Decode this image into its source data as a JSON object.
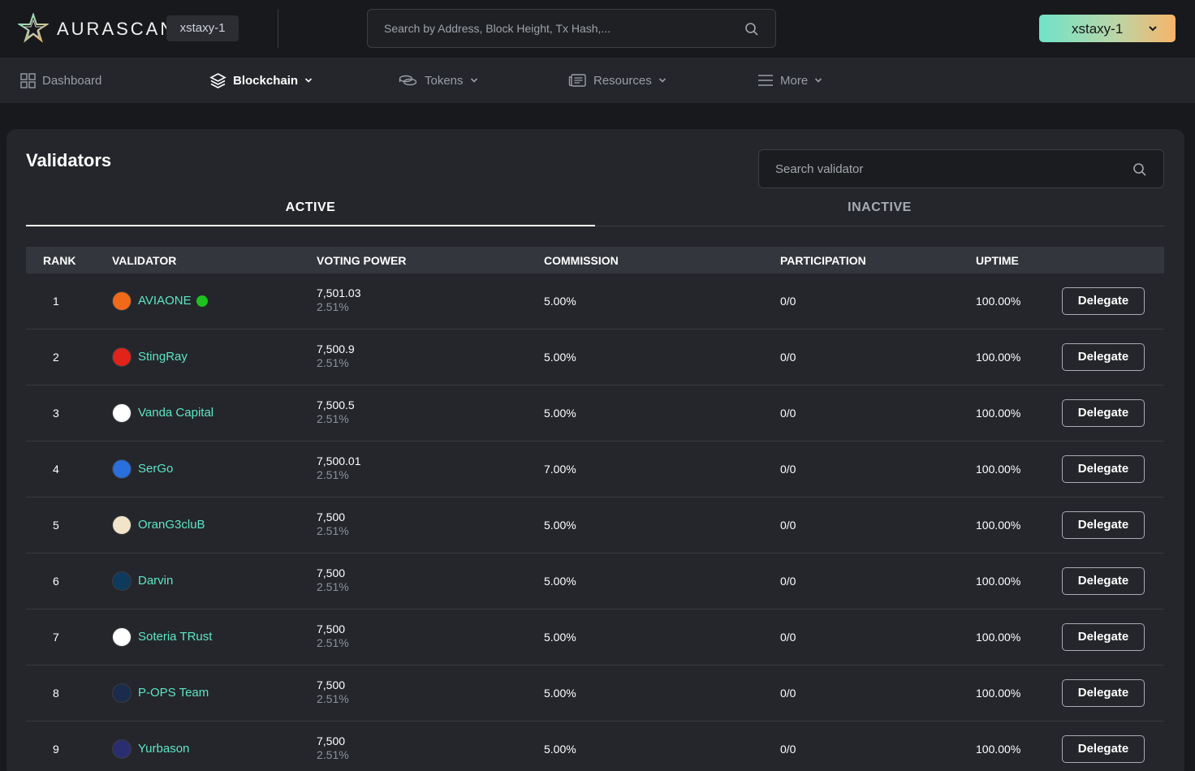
{
  "header": {
    "brand": "AURASCAN",
    "network_badge": "xstaxy-1",
    "search_placeholder": "Search by Address, Block Height, Tx Hash,...",
    "network_select": "xstaxy-1"
  },
  "nav": {
    "items": [
      {
        "label": "Dashboard",
        "icon": "grid-icon",
        "active": false
      },
      {
        "label": "Blockchain",
        "icon": "layers-icon",
        "active": true
      },
      {
        "label": "Tokens",
        "icon": "coins-icon",
        "active": false
      },
      {
        "label": "Resources",
        "icon": "newspaper-icon",
        "active": false
      },
      {
        "label": "More",
        "icon": "menu-icon",
        "active": false
      }
    ]
  },
  "page": {
    "title": "Validators",
    "search_placeholder": "Search validator",
    "tabs": [
      "ACTIVE",
      "INACTIVE"
    ],
    "active_tab": "ACTIVE"
  },
  "table": {
    "headers": [
      "RANK",
      "VALIDATOR",
      "VOTING POWER",
      "COMMISSION",
      "PARTICIPATION",
      "UPTIME"
    ],
    "delegate_label": "Delegate",
    "rows": [
      {
        "rank": "1",
        "name": "AVIAONE",
        "online": true,
        "power": "7,501.03",
        "percent": "2.51%",
        "commission": "5.00%",
        "participation": "0/0",
        "uptime": "100.00%",
        "avatar_color": "#f06a1a"
      },
      {
        "rank": "2",
        "name": "StingRay",
        "online": false,
        "power": "7,500.9",
        "percent": "2.51%",
        "commission": "5.00%",
        "participation": "0/0",
        "uptime": "100.00%",
        "avatar_color": "#e2231a"
      },
      {
        "rank": "3",
        "name": "Vanda Capital",
        "online": false,
        "power": "7,500.5",
        "percent": "2.51%",
        "commission": "5.00%",
        "participation": "0/0",
        "uptime": "100.00%",
        "avatar_color": "#ffffff"
      },
      {
        "rank": "4",
        "name": "SerGo",
        "online": false,
        "power": "7,500.01",
        "percent": "2.51%",
        "commission": "7.00%",
        "participation": "0/0",
        "uptime": "100.00%",
        "avatar_color": "#2a6fdb"
      },
      {
        "rank": "5",
        "name": "OranG3cluB",
        "online": false,
        "power": "7,500",
        "percent": "2.51%",
        "commission": "5.00%",
        "participation": "0/0",
        "uptime": "100.00%",
        "avatar_color": "#f1e4c8"
      },
      {
        "rank": "6",
        "name": "Darvin",
        "online": false,
        "power": "7,500",
        "percent": "2.51%",
        "commission": "5.00%",
        "participation": "0/0",
        "uptime": "100.00%",
        "avatar_color": "#0e3a5c"
      },
      {
        "rank": "7",
        "name": "Soteria TRust",
        "online": false,
        "power": "7,500",
        "percent": "2.51%",
        "commission": "5.00%",
        "participation": "0/0",
        "uptime": "100.00%",
        "avatar_color": "#ffffff"
      },
      {
        "rank": "8",
        "name": "P-OPS Team",
        "online": false,
        "power": "7,500",
        "percent": "2.51%",
        "commission": "5.00%",
        "participation": "0/0",
        "uptime": "100.00%",
        "avatar_color": "#1a2b4c"
      },
      {
        "rank": "9",
        "name": "Yurbason",
        "online": false,
        "power": "7,500",
        "percent": "2.51%",
        "commission": "5.00%",
        "participation": "0/0",
        "uptime": "100.00%",
        "avatar_color": "#2b2e6e"
      }
    ]
  },
  "colors": {
    "accent": "#5ee6c5",
    "online": "#1ec21e",
    "background": "#18191c",
    "card": "#24262b"
  }
}
